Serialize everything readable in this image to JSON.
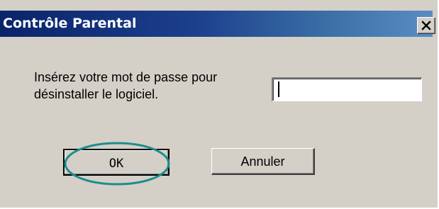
{
  "dialog": {
    "title": "Contrôle Parental",
    "prompt": "Insérez votre  mot de passe pour\ndésinstaller le logiciel.",
    "password_value": "",
    "ok_label": "OK",
    "cancel_label": "Annuler",
    "close_icon": "close-icon"
  },
  "colors": {
    "titlebar_start": "#0a246a",
    "titlebar_end": "#5a8cc4",
    "window_bg": "#d4d0c8",
    "highlight_ellipse": "#1f8c8c"
  }
}
